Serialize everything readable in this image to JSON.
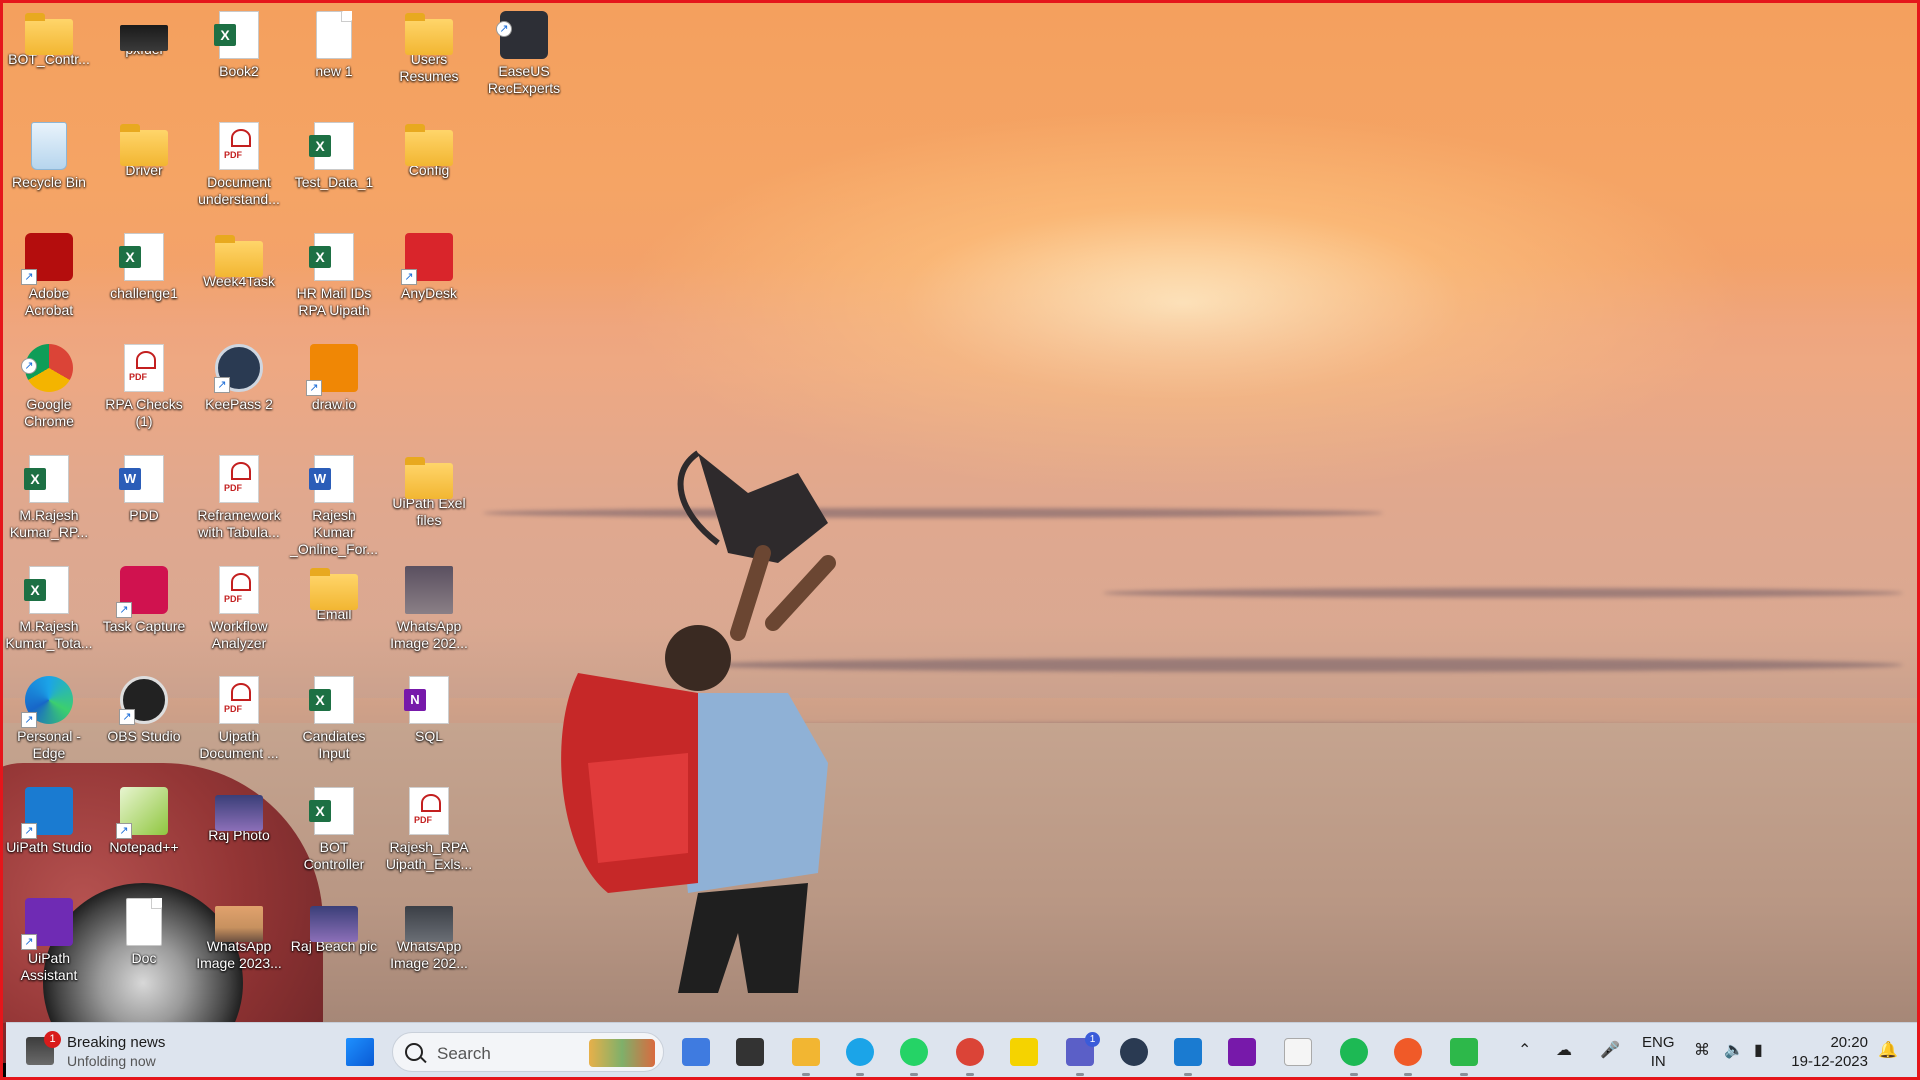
{
  "desktop": {
    "icons": [
      {
        "label": "BOT_Contr...",
        "kind": "folder",
        "x": 0,
        "y": 0
      },
      {
        "label": "pxfuel",
        "kind": "pxfuel"
      },
      {
        "label": "Book2",
        "kind": "xls"
      },
      {
        "label": "new 1",
        "kind": "doc"
      },
      {
        "label": "Users Resumes",
        "kind": "folder"
      },
      {
        "label": "EaseUS RecExperts",
        "kind": "easeus"
      },
      {
        "label": "Recycle Bin",
        "kind": "recycle"
      },
      {
        "label": "Driver",
        "kind": "folder"
      },
      {
        "label": "Document understand...",
        "kind": "pdf"
      },
      {
        "label": "Test_Data_1",
        "kind": "xls"
      },
      {
        "label": "Config",
        "kind": "folder"
      },
      {
        "label": "Adobe Acrobat",
        "kind": "acrobat"
      },
      {
        "label": "challenge1",
        "kind": "xls"
      },
      {
        "label": "Week4Task",
        "kind": "folder"
      },
      {
        "label": "HR Mail IDs RPA Uipath",
        "kind": "xls"
      },
      {
        "label": "AnyDesk",
        "kind": "red"
      },
      {
        "label": "Google Chrome",
        "kind": "chrome"
      },
      {
        "label": "RPA Checks (1)",
        "kind": "pdf"
      },
      {
        "label": "KeePass 2",
        "kind": "keepass"
      },
      {
        "label": "draw.io",
        "kind": "drawio"
      },
      {
        "label": "M.Rajesh Kumar_RP...",
        "kind": "xls"
      },
      {
        "label": "PDD",
        "kind": "word"
      },
      {
        "label": "Reframework with Tabula...",
        "kind": "pdf"
      },
      {
        "label": "Rajesh Kumar _Online_For...",
        "kind": "word"
      },
      {
        "label": "UiPath Exel files",
        "kind": "folder"
      },
      {
        "label": "M.Rajesh Kumar_Tota...",
        "kind": "xls"
      },
      {
        "label": "Task Capture",
        "kind": "taskcap"
      },
      {
        "label": "Workflow Analyzer",
        "kind": "pdf"
      },
      {
        "label": "Email",
        "kind": "folder"
      },
      {
        "label": "WhatsApp Image 202...",
        "kind": "wa"
      },
      {
        "label": "Personal - Edge",
        "kind": "edge"
      },
      {
        "label": "OBS Studio",
        "kind": "obs"
      },
      {
        "label": "Uipath Document ...",
        "kind": "pdf"
      },
      {
        "label": "Candiates Input",
        "kind": "xls"
      },
      {
        "label": "SQL",
        "kind": "onenote"
      },
      {
        "label": "UiPath Studio",
        "kind": "uipath"
      },
      {
        "label": "Notepad++",
        "kind": "notepad"
      },
      {
        "label": "Raj Photo",
        "kind": "photo"
      },
      {
        "label": "BOT Controller",
        "kind": "xls"
      },
      {
        "label": "Rajesh_RPA Uipath_Exls...",
        "kind": "pdf"
      },
      {
        "label": "UiPath Assistant",
        "kind": "uiassist"
      },
      {
        "label": "Doc",
        "kind": "doc"
      },
      {
        "label": "WhatsApp Image 2023...",
        "kind": "beach"
      },
      {
        "label": "Raj Beach pic",
        "kind": "photo"
      },
      {
        "label": "WhatsApp Image 202...",
        "kind": "dark"
      }
    ]
  },
  "taskbar": {
    "news": {
      "badge": "1",
      "title": "Breaking news",
      "subtitle": "Unfolding now"
    },
    "search_placeholder": "Search",
    "apps": [
      {
        "name": "start",
        "color": "#1a73e8"
      },
      {
        "name": "copilot",
        "color": "#3f7be0"
      },
      {
        "name": "task-view",
        "color": "#333333"
      },
      {
        "name": "file-explorer",
        "color": "#f2b632"
      },
      {
        "name": "edge",
        "color": "#1ba4e8"
      },
      {
        "name": "whatsapp",
        "color": "#25d366"
      },
      {
        "name": "chrome",
        "color": "#db4437"
      },
      {
        "name": "sticky-notes",
        "color": "#f5d300"
      },
      {
        "name": "teams",
        "color": "#5b5fc7",
        "badge": "1"
      },
      {
        "name": "keepass",
        "color": "#2a3a52"
      },
      {
        "name": "uipath-studio",
        "color": "#1a7bd1"
      },
      {
        "name": "onenote",
        "color": "#7719aa"
      },
      {
        "name": "notepad",
        "color": "#f5f5f5"
      },
      {
        "name": "spotify",
        "color": "#1db954"
      },
      {
        "name": "easeus",
        "color": "#f05a28"
      },
      {
        "name": "media-player",
        "color": "#2db84a"
      }
    ],
    "lang": {
      "line1": "ENG",
      "line2": "IN"
    },
    "clock": {
      "time": "20:20",
      "date": "19-12-2023"
    }
  }
}
